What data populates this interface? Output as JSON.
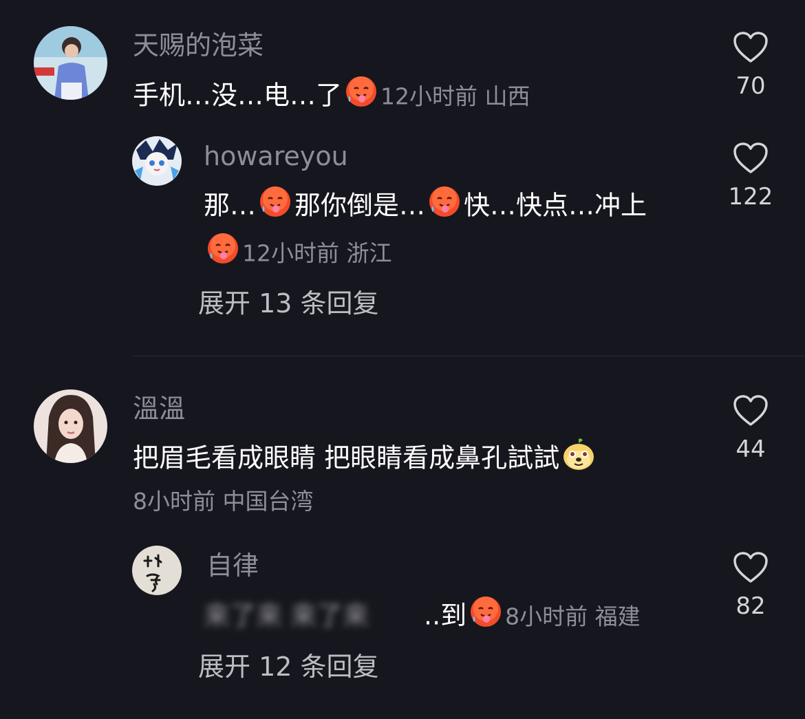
{
  "comments": [
    {
      "username": "天赐的泡菜",
      "text": "手机…没…电…了",
      "emoji": "hot-face-emoji",
      "time": "12小时前",
      "location": "山西",
      "likes": "70",
      "replies": [
        {
          "username": "howareyou",
          "text_parts": [
            "那…",
            "那你倒是…",
            "快…快点…冲上"
          ],
          "emoji": "hot-face-emoji",
          "time": "12小时前",
          "location": "浙江",
          "likes": "122"
        }
      ],
      "expand_label": "展开 13 条回复"
    },
    {
      "username": "溫溫",
      "text": "把眉毛看成眼睛 把眼睛看成鼻孔試試",
      "emoji": "doge-face-emoji",
      "time": "8小时前",
      "location": "中国台湾",
      "likes": "44",
      "replies": [
        {
          "username": "自律",
          "blurred_text": "来了来 来了来",
          "text": "..到",
          "emoji": "hot-face-emoji",
          "time": "8小时前",
          "location": "福建",
          "likes": "82"
        }
      ],
      "expand_label": "展开 12 条回复"
    }
  ],
  "colors": {
    "background": "#16161e",
    "username": "#8e8e97",
    "text": "#ffffff",
    "divider": "#2c2c35"
  }
}
